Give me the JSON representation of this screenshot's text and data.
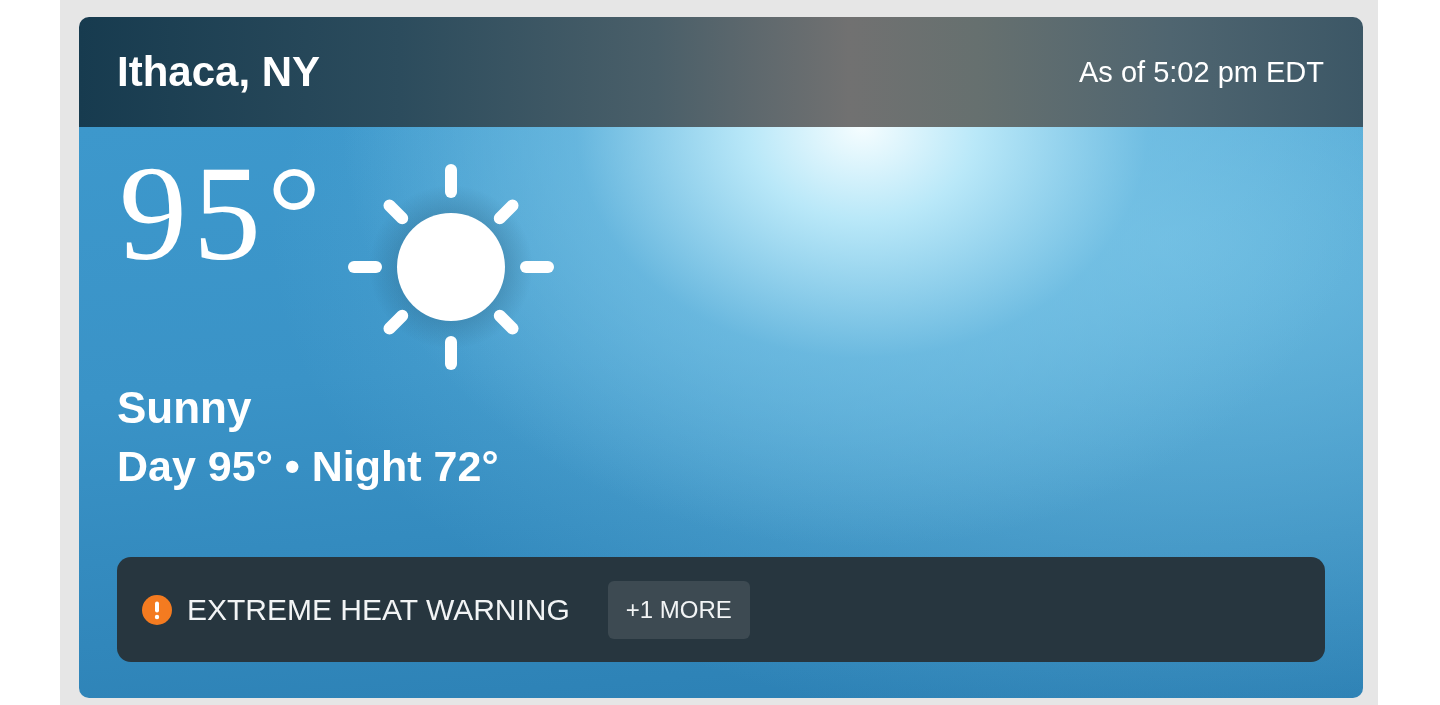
{
  "header": {
    "location": "Ithaca, NY",
    "as_of": "As of 5:02 pm EDT"
  },
  "current": {
    "temperature": "95°",
    "condition": "Sunny",
    "day_night": "Day 95° • Night 72°"
  },
  "alert": {
    "title": "EXTREME HEAT WARNING",
    "more": "+1 MORE"
  }
}
